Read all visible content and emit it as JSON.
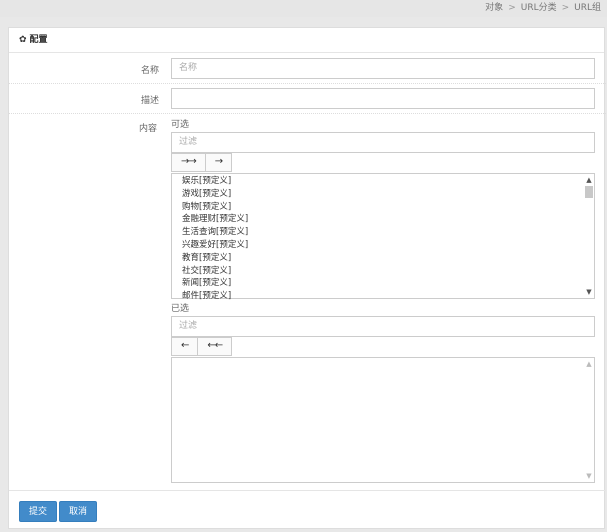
{
  "breadcrumb": {
    "items": [
      "对象",
      "URL分类",
      "URL组"
    ],
    "separator": ">"
  },
  "panel": {
    "title": "配置",
    "icon": "gear-icon"
  },
  "form": {
    "name": {
      "label": "名称",
      "placeholder": "名称",
      "value": ""
    },
    "desc": {
      "label": "描述",
      "placeholder": "",
      "value": ""
    },
    "content": {
      "label": "内容",
      "available": {
        "label": "可选",
        "filter_placeholder": "过滤",
        "buttons": [
          "→→",
          "→"
        ],
        "items": [
          "娱乐[预定义]",
          "游戏[预定义]",
          "购物[预定义]",
          "金融理财[预定义]",
          "生活查询[预定义]",
          "兴趣爱好[预定义]",
          "教育[预定义]",
          "社交[预定义]",
          "新闻[预定义]",
          "邮件[预定义]"
        ]
      },
      "selected": {
        "label": "已选",
        "filter_placeholder": "过滤",
        "buttons": [
          "←",
          "←←"
        ],
        "items": []
      }
    }
  },
  "footer": {
    "submit_label": "提交",
    "cancel_label": "取消"
  },
  "colors": {
    "primary": "#428bca",
    "page_bg": "#e8e8e8"
  }
}
